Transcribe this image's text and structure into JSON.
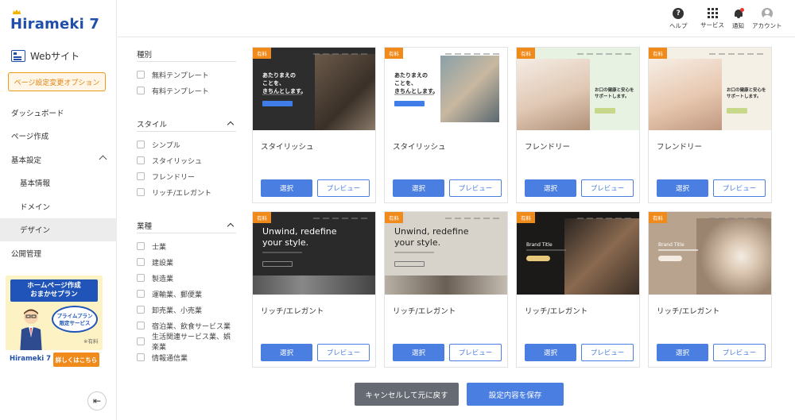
{
  "brand": {
    "logo_text": "Hirameki 7",
    "accent": "#1f4fa8"
  },
  "sidebar": {
    "site_label": "Webサイト",
    "option_button": "ページ設定変更オプション",
    "items": [
      {
        "label": "ダッシュボード"
      },
      {
        "label": "ページ作成"
      },
      {
        "label": "基本設定"
      },
      {
        "label": "基本情報"
      },
      {
        "label": "ドメイン"
      },
      {
        "label": "デザイン"
      },
      {
        "label": "公開管理"
      }
    ],
    "banner": {
      "title_line1": "ホームページ作成",
      "title_line2": "おまかせプラン",
      "badge_line1": "プライムプラン",
      "badge_line2": "限定サービス",
      "note": "※有料",
      "logo": "Hirameki 7",
      "cta": "詳しくはこちら"
    }
  },
  "topbar": {
    "help": "ヘルプ",
    "services": "サービス",
    "notifications": "通知",
    "account": "アカウント"
  },
  "filters": {
    "type": {
      "title": "種別",
      "options": [
        "無料テンプレート",
        "有料テンプレート"
      ]
    },
    "style": {
      "title": "スタイル",
      "options": [
        "シンプル",
        "スタイリッシュ",
        "フレンドリー",
        "リッチ/エレガント"
      ]
    },
    "industry": {
      "title": "業種",
      "options": [
        "士業",
        "建設業",
        "製造業",
        "運輸業、郵便業",
        "卸売業、小売業",
        "宿泊業、飲食サービス業",
        "生活関連サービス業、娯楽業",
        "情報通信業"
      ]
    }
  },
  "cards": [
    {
      "badge": "有料",
      "label": "スタイリッシュ",
      "hero": "あたりまえの\nことを、\nきちんとします。",
      "select": "選択",
      "preview": "プレビュー"
    },
    {
      "badge": "有料",
      "label": "スタイリッシュ",
      "hero": "あたりまえの\nことを、\nきちんとします。",
      "select": "選択",
      "preview": "プレビュー"
    },
    {
      "badge": "有料",
      "label": "フレンドリー",
      "hero": "お口の健康と安心を\nサポートします。",
      "select": "選択",
      "preview": "プレビュー"
    },
    {
      "badge": "有料",
      "label": "フレンドリー",
      "hero": "お口の健康と安心を\nサポートします。",
      "select": "選択",
      "preview": "プレビュー"
    },
    {
      "badge": "有料",
      "label": "リッチ/エレガント",
      "hero": "Unwind, redefine\nyour style.",
      "select": "選択",
      "preview": "プレビュー"
    },
    {
      "badge": "有料",
      "label": "リッチ/エレガント",
      "hero": "Unwind, redefine\nyour style.",
      "select": "選択",
      "preview": "プレビュー"
    },
    {
      "badge": "有料",
      "label": "リッチ/エレガント",
      "hero": "Brand Title",
      "select": "選択",
      "preview": "プレビュー"
    },
    {
      "badge": "有料",
      "label": "リッチ/エレガント",
      "hero": "Brand Title",
      "select": "選択",
      "preview": "プレビュー"
    }
  ],
  "footer": {
    "cancel": "キャンセルして元に戻す",
    "save": "設定内容を保存"
  }
}
